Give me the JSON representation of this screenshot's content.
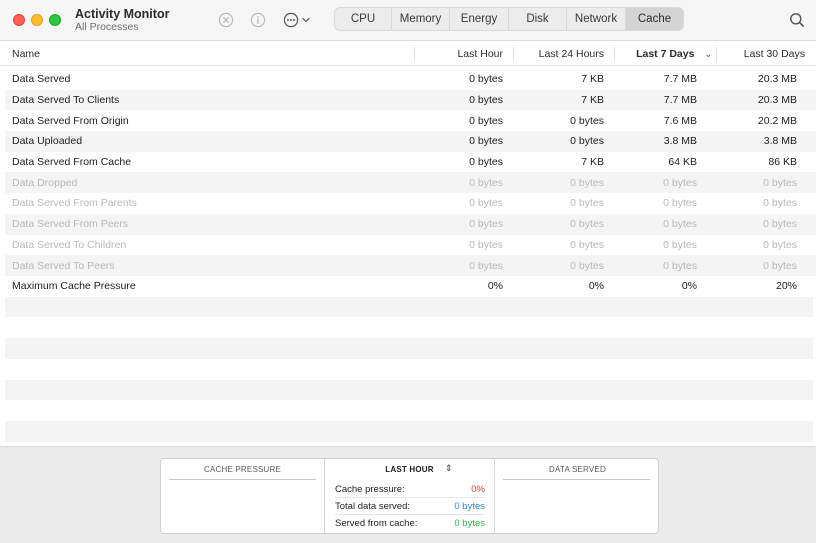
{
  "window": {
    "title": "Activity Monitor",
    "subtitle": "All Processes"
  },
  "toolbar": {
    "stop_icon": "stop-process-icon",
    "info_icon": "info-icon",
    "more_icon": "more-actions-icon",
    "search_icon": "search-icon",
    "tabs": [
      {
        "label": "CPU",
        "active": false
      },
      {
        "label": "Memory",
        "active": false
      },
      {
        "label": "Energy",
        "active": false
      },
      {
        "label": "Disk",
        "active": false
      },
      {
        "label": "Network",
        "active": false
      },
      {
        "label": "Cache",
        "active": true
      }
    ]
  },
  "columns": {
    "name": "Name",
    "last_hour": "Last Hour",
    "last_24_hours": "Last 24 Hours",
    "last_7_days": "Last 7 Days",
    "last_30_days": "Last 30 Days",
    "sorted_column": "last_7_days"
  },
  "rows": [
    {
      "name": "Data Served",
      "h": "0 bytes",
      "d": "7 KB",
      "w": "7.7 MB",
      "m": "20.3 MB",
      "dim": false
    },
    {
      "name": "Data Served To Clients",
      "h": "0 bytes",
      "d": "7 KB",
      "w": "7.7 MB",
      "m": "20.3 MB",
      "dim": false
    },
    {
      "name": "Data Served From Origin",
      "h": "0 bytes",
      "d": "0 bytes",
      "w": "7.6 MB",
      "m": "20.2 MB",
      "dim": false
    },
    {
      "name": "Data Uploaded",
      "h": "0 bytes",
      "d": "0 bytes",
      "w": "3.8 MB",
      "m": "3.8 MB",
      "dim": false
    },
    {
      "name": "Data Served From Cache",
      "h": "0 bytes",
      "d": "7 KB",
      "w": "64 KB",
      "m": "86 KB",
      "dim": false
    },
    {
      "name": "Data Dropped",
      "h": "0 bytes",
      "d": "0 bytes",
      "w": "0 bytes",
      "m": "0 bytes",
      "dim": true
    },
    {
      "name": "Data Served From Parents",
      "h": "0 bytes",
      "d": "0 bytes",
      "w": "0 bytes",
      "m": "0 bytes",
      "dim": true
    },
    {
      "name": "Data Served From Peers",
      "h": "0 bytes",
      "d": "0 bytes",
      "w": "0 bytes",
      "m": "0 bytes",
      "dim": true
    },
    {
      "name": "Data Served To Children",
      "h": "0 bytes",
      "d": "0 bytes",
      "w": "0 bytes",
      "m": "0 bytes",
      "dim": true
    },
    {
      "name": "Data Served To Peers",
      "h": "0 bytes",
      "d": "0 bytes",
      "w": "0 bytes",
      "m": "0 bytes",
      "dim": true
    },
    {
      "name": "Maximum Cache Pressure",
      "h": "0%",
      "d": "0%",
      "w": "0%",
      "m": "20%",
      "dim": false
    }
  ],
  "bottom": {
    "cache_pressure_title": "CACHE PRESSURE",
    "period_title": "LAST HOUR",
    "data_served_title": "DATA SERVED",
    "stats": {
      "cache_pressure_label": "Cache pressure:",
      "cache_pressure_value": "0%",
      "total_served_label": "Total data served:",
      "total_served_value": "0 bytes",
      "served_from_cache_label": "Served from cache:",
      "served_from_cache_value": "0 bytes"
    },
    "colors": {
      "pressure": "#e0443e",
      "total": "#2a8ee0",
      "cache": "#2bbd43"
    }
  }
}
